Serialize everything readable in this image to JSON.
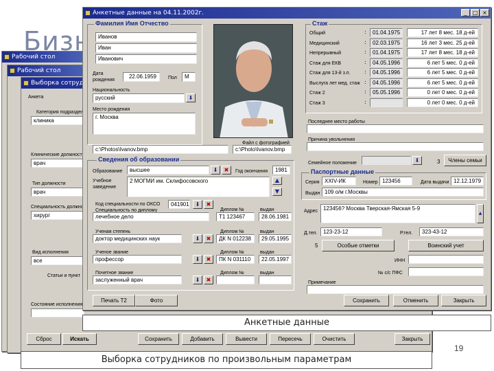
{
  "slide": {
    "title": "Бизн",
    "page_number": "19"
  },
  "desk_win": {
    "title": "Рабочий стол",
    "inner_title": "Рабочий стол",
    "sel_title": "Выборка сотрудников",
    "labels": {
      "anketa": "Анкета",
      "category": "Категория подразделения",
      "position": "Клинические должности",
      "doc_type": "Тип должности",
      "specialty": "Специальность должности",
      "vid": "Вид исполнения",
      "status_group": "Статьи и пункт",
      "state": "Состояние исполнения"
    },
    "values": {
      "category": "клиника",
      "position": "врач",
      "doc_type": "врач",
      "specialty": "хирург",
      "vid": "все"
    },
    "buttons": [
      "Сброс",
      "Искать",
      "Сохранить",
      "Добавить",
      "Вывести",
      "Пересечь",
      "Очистить",
      "Закрыть"
    ]
  },
  "form": {
    "title": "Анкетные данные на 04.11.2002г.",
    "fio": {
      "section": "Фамилия Имя Отчество",
      "last": "Иванов",
      "first": "Иван",
      "middle": "Иванович"
    },
    "birth": {
      "label": "Дата рождения",
      "value": "22.06.1959",
      "sex_label": "Пол",
      "sex": "М"
    },
    "nationality": {
      "label": "Национальность",
      "value": "русский"
    },
    "birthplace": {
      "label": "Место рождения",
      "value": "г. Москва"
    },
    "photo": {
      "path_label": "Файл с фотографией",
      "path": "c:\\Photos\\Ivanov.bmp",
      "path2": "c:\\Photo\\Ivanov.bmp"
    },
    "education": {
      "section": "Сведения об образовании",
      "edu_label": "Образование",
      "edu_value": "высшее",
      "end_year_label": "Год окончания",
      "end_year": "1981",
      "inst_label": "Учебное заведение",
      "inst": "2 МОГМИ им. Склифосовского",
      "spec_code_label": "Код специальности по ОКСО",
      "spec_code": "041901",
      "spec_label": "Специальность по диплому",
      "spec": "лечебное дело",
      "diploma_label": "Диплом №",
      "diploma": "Т1 123467",
      "issued_label": "выдан",
      "issued": "28.06.1981",
      "degree_label": "Ученая степень",
      "degree": "доктор медицинских наук",
      "degree_dipl": "ДК N 012238",
      "degree_date": "29.05.1995",
      "title_label": "Ученое звание",
      "title_value": "профессор",
      "title_dipl": "ПК N 031110",
      "title_date": "22.05.1997",
      "hon_label": "Почетное звание",
      "hon_value": "заслуженный врач"
    },
    "stazh": {
      "section": "Стаж",
      "rows": [
        {
          "label": "Общий",
          "date": "01.04.1975",
          "dur": "17 лет 8 мес. 18 д-ей"
        },
        {
          "label": "Медицинский",
          "date": "02.03.1975",
          "dur": "16 лет 3 мес. 25 д-ей"
        },
        {
          "label": "Непрерывный",
          "date": "01.04.1975",
          "dur": "17 лет 8 мес. 18 д-ей"
        },
        {
          "label": "Стаж для ЕКВ",
          "date": "04.05.1996",
          "dur": "6 лет 5 мес. 0 д-ей"
        },
        {
          "label": "Стаж для 13-й з.п.",
          "date": "04.05.1996",
          "dur": "6 лет 5 мес. 0 д-ей"
        },
        {
          "label": "Выслуга лет мед. стаж",
          "date": "04.05.1996",
          "dur": "6 лет 5 мес. 0 д-ей"
        },
        {
          "label": "Стаж 2",
          "date": "05.05.1996",
          "dur": "0 лет 0 мес. 0 д-ей"
        },
        {
          "label": "Стаж 3",
          "date": "",
          "dur": "0 лет 0 мес. 0 д-ей"
        }
      ]
    },
    "last_work_label": "Последнее место работы",
    "reason_label": "Причина увольнения",
    "family": {
      "label": "Семейное положение",
      "count": "3",
      "members_btn": "Члены семьи"
    },
    "passport": {
      "section": "Паспортные данные",
      "series_label": "Серия",
      "series": "XXIV-ИК",
      "number_label": "Номер",
      "number": "123456",
      "issue_date_label": "Дата выдачи",
      "issue_date": "12.12.1979",
      "issued_label": "Выдан",
      "issued": "109 о/м г.Москвы"
    },
    "address": {
      "label": "Адрес",
      "value": "123456? Москва Тверская-Ямская 5-9",
      "phone_label": "Д.тел.",
      "phone": "123-23-12",
      "work_phone_label": "Р.тел.",
      "work_phone": "323-43-12"
    },
    "num5": "5",
    "special_btn": "Особые отметки",
    "military_btn": "Воинский учет",
    "inn_label": "ИНН",
    "pfr_label": "№ с/с ПФС",
    "note_label": "Примечание",
    "buttons": {
      "print": "Печать Т2",
      "photo": "Фото",
      "save": "Сохранить",
      "cancel": "Отменить",
      "close": "Закрыть"
    }
  },
  "captions": {
    "form": "Анкетные данные",
    "select": "Выборка сотрудников по произвольным параметрам"
  },
  "colors": {
    "titlebar": "#1b2a8f",
    "section": "#1c2a8c",
    "window": "#d4d0c8"
  }
}
